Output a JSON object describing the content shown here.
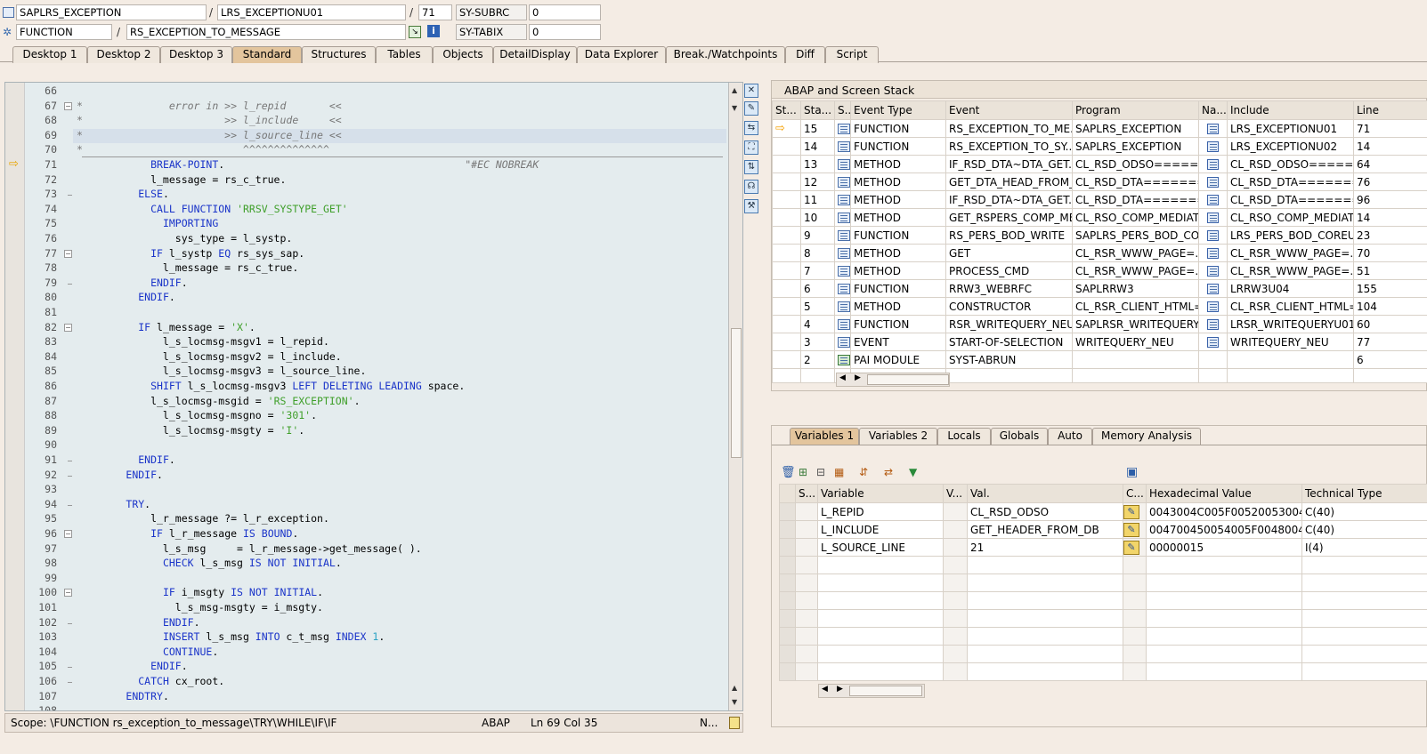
{
  "header": {
    "program": "SAPLRS_EXCEPTION",
    "include": "LRS_EXCEPTIONU01",
    "line": "71",
    "var1_name": "SY-SUBRC",
    "var1_value": "0",
    "type": "FUNCTION",
    "name": "RS_EXCEPTION_TO_MESSAGE",
    "var2_name": "SY-TABIX",
    "var2_value": "0",
    "sep": "/"
  },
  "tabs": [
    "Desktop 1",
    "Desktop 2",
    "Desktop 3",
    "Standard",
    "Structures",
    "Tables",
    "Objects",
    "DetailDisplay",
    "Data Explorer",
    "Break./Watchpoints",
    "Diff",
    "Script"
  ],
  "code": [
    {
      "n": "66",
      "t": ""
    },
    {
      "n": "67",
      "t": "*              error in >> l_repid       <<"
    },
    {
      "n": "68",
      "t": "*                       >> l_include     <<"
    },
    {
      "n": "69",
      "t": "*                       >> l_source_line <<"
    },
    {
      "n": "70",
      "t": "*                          ^^^^^^^^^^^^^^"
    },
    {
      "n": "71",
      "t": "            BREAK-POINT.                                       \"#EC NOBREAK"
    },
    {
      "n": "72",
      "t": "            l_message = rs_c_true."
    },
    {
      "n": "73",
      "t": "          ELSE."
    },
    {
      "n": "74",
      "t": "            CALL FUNCTION 'RRSV_SYSTYPE_GET'"
    },
    {
      "n": "75",
      "t": "              IMPORTING"
    },
    {
      "n": "76",
      "t": "                sys_type = l_systp."
    },
    {
      "n": "77",
      "t": "            IF l_systp EQ rs_sys_sap."
    },
    {
      "n": "78",
      "t": "              l_message = rs_c_true."
    },
    {
      "n": "79",
      "t": "            ENDIF."
    },
    {
      "n": "80",
      "t": "          ENDIF."
    },
    {
      "n": "81",
      "t": ""
    },
    {
      "n": "82",
      "t": "          IF l_message = 'X'."
    },
    {
      "n": "83",
      "t": "              l_s_locmsg-msgv1 = l_repid."
    },
    {
      "n": "84",
      "t": "              l_s_locmsg-msgv2 = l_include."
    },
    {
      "n": "85",
      "t": "              l_s_locmsg-msgv3 = l_source_line."
    },
    {
      "n": "86",
      "t": "            SHIFT l_s_locmsg-msgv3 LEFT DELETING LEADING space."
    },
    {
      "n": "87",
      "t": "            l_s_locmsg-msgid = 'RS_EXCEPTION'."
    },
    {
      "n": "88",
      "t": "              l_s_locmsg-msgno = '301'."
    },
    {
      "n": "89",
      "t": "              l_s_locmsg-msgty = 'I'."
    },
    {
      "n": "90",
      "t": ""
    },
    {
      "n": "91",
      "t": "          ENDIF."
    },
    {
      "n": "92",
      "t": "        ENDIF."
    },
    {
      "n": "93",
      "t": ""
    },
    {
      "n": "94",
      "t": "        TRY."
    },
    {
      "n": "95",
      "t": "            l_r_message ?= l_r_exception."
    },
    {
      "n": "96",
      "t": "            IF l_r_message IS BOUND."
    },
    {
      "n": "97",
      "t": "              l_s_msg     = l_r_message->get_message( )."
    },
    {
      "n": "98",
      "t": "              CHECK l_s_msg IS NOT INITIAL."
    },
    {
      "n": "99",
      "t": ""
    },
    {
      "n": "100",
      "t": "              IF i_msgty IS NOT INITIAL."
    },
    {
      "n": "101",
      "t": "                l_s_msg-msgty = i_msgty."
    },
    {
      "n": "102",
      "t": "              ENDIF."
    },
    {
      "n": "103",
      "t": "              INSERT l_s_msg INTO c_t_msg INDEX 1."
    },
    {
      "n": "104",
      "t": "              CONTINUE."
    },
    {
      "n": "105",
      "t": "            ENDIF."
    },
    {
      "n": "106",
      "t": "          CATCH cx_root."
    },
    {
      "n": "107",
      "t": "        ENDTRY."
    },
    {
      "n": "108",
      "t": ""
    }
  ],
  "status": {
    "scope": "Scope: \\FUNCTION rs_exception_to_message\\TRY\\WHILE\\IF\\IF",
    "lang": "ABAP",
    "pos": "Ln  69 Col  35",
    "mode": "N..."
  },
  "stack": {
    "title": "ABAP and Screen Stack",
    "columns": [
      "St...",
      "Sta...",
      "S...",
      "Event Type",
      "Event",
      "Program",
      "Na...",
      "Include",
      "Line"
    ],
    "rows": [
      [
        "15",
        "FUNCTION",
        "RS_EXCEPTION_TO_ME...",
        "SAPLRS_EXCEPTION",
        "LRS_EXCEPTIONU01",
        "71"
      ],
      [
        "14",
        "FUNCTION",
        "RS_EXCEPTION_TO_SY...",
        "SAPLRS_EXCEPTION",
        "LRS_EXCEPTIONU02",
        "14"
      ],
      [
        "13",
        "METHOD",
        "IF_RSD_DTA~DTA_GET...",
        "CL_RSD_ODSO=======...",
        "CL_RSD_ODSO=======...",
        "64"
      ],
      [
        "12",
        "METHOD",
        "GET_DTA_HEAD_FROM_...",
        "CL_RSD_DTA========...",
        "CL_RSD_DTA========...",
        "76"
      ],
      [
        "11",
        "METHOD",
        "IF_RSD_DTA~DTA_GET...",
        "CL_RSD_DTA========...",
        "CL_RSD_DTA========...",
        "96"
      ],
      [
        "10",
        "METHOD",
        "GET_RSPERS_COMP_ME...",
        "CL_RSO_COMP_MEDIAT...",
        "CL_RSO_COMP_MEDIAT...",
        "14"
      ],
      [
        "9",
        "FUNCTION",
        "RS_PERS_BOD_WRITE",
        "SAPLRS_PERS_BOD_COR...",
        "LRS_PERS_BOD_COREU0...",
        "23"
      ],
      [
        "8",
        "METHOD",
        "GET",
        "CL_RSR_WWW_PAGE=...",
        "CL_RSR_WWW_PAGE=...",
        "70"
      ],
      [
        "7",
        "METHOD",
        "PROCESS_CMD",
        "CL_RSR_WWW_PAGE=...",
        "CL_RSR_WWW_PAGE=...",
        "51"
      ],
      [
        "6",
        "FUNCTION",
        "RRW3_WEBRFC",
        "SAPLRRW3",
        "LRRW3U04",
        "155"
      ],
      [
        "5",
        "METHOD",
        "CONSTRUCTOR",
        "CL_RSR_CLIENT_HTML=...",
        "CL_RSR_CLIENT_HTML=...",
        "104"
      ],
      [
        "4",
        "FUNCTION",
        "RSR_WRITEQUERY_NEU",
        "SAPLRSR_WRITEQUERY",
        "LRSR_WRITEQUERYU01",
        "60"
      ],
      [
        "3",
        "EVENT",
        "START-OF-SELECTION",
        "WRITEQUERY_NEU",
        "WRITEQUERY_NEU",
        "77"
      ],
      [
        "2",
        "PAI MODULE",
        "SYST-ABRUN",
        "",
        "",
        "6"
      ]
    ]
  },
  "vars": {
    "tabs": [
      "Variables 1",
      "Variables 2",
      "Locals",
      "Globals",
      "Auto",
      "Memory Analysis"
    ],
    "columns": [
      "S...",
      "Variable",
      "V...",
      "Val.",
      "C...",
      "Hexadecimal Value",
      "Technical Type"
    ],
    "rows": [
      [
        "L_REPID",
        "CL_RSD_ODSO",
        "0043004C005F005200530044...",
        "C(40)"
      ],
      [
        "L_INCLUDE",
        "GET_HEADER_FROM_DB",
        "004700450054005F00480045...",
        "C(40)"
      ],
      [
        "L_SOURCE_LINE",
        "21",
        "00000015",
        "I(4)"
      ]
    ]
  }
}
